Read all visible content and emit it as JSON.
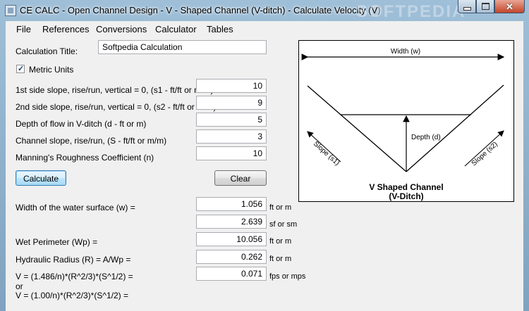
{
  "window": {
    "title": "CE CALC - Open Channel Design - V - Shaped Channel (V-ditch) - Calculate Velocity (V)",
    "watermark": "SOFTPEDIA",
    "close_glyph": "✕"
  },
  "menu": [
    "File",
    "References",
    "Conversions",
    "Calculator",
    "Tables"
  ],
  "form": {
    "calc_title_label": "Calculation Title:",
    "calc_title_value": "Softpedia Calculation",
    "metric_label": "Metric Units",
    "metric_checked": true,
    "check_glyph": "✓",
    "inputs": [
      {
        "label": "1st side slope, rise/run, vertical = 0, (s1 - ft/ft or m/m)",
        "value": "10"
      },
      {
        "label": "2nd side slope, rise/run, vertical = 0, (s2 - ft/ft or m/m)",
        "value": "9"
      },
      {
        "label": "Depth of flow in V-ditch (d - ft or m)",
        "value": "5"
      },
      {
        "label": "Channel slope, rise/run, (S - ft/ft or m/m)",
        "value": "3"
      },
      {
        "label": "Manning's Roughness Coefficient (n)",
        "value": "10"
      }
    ],
    "calculate_label": "Calculate",
    "clear_label": "Clear"
  },
  "results": [
    {
      "label": "Width of the water surface (w) =",
      "value": "1.056",
      "unit": "ft or m"
    },
    {
      "label": "",
      "value": "2.639",
      "unit": "sf or sm"
    },
    {
      "label": "Wet Perimeter (Wp) =",
      "value": "10.056",
      "unit": "ft or m"
    },
    {
      "label": "Hydraulic Radius (R) = A/Wp =",
      "value": "0.262",
      "unit": "ft or m"
    },
    {
      "label": "V   = (1.486/n)*(R^2/3)*(S^1/2) =",
      "value": "0.071",
      "unit": "fps or mps"
    }
  ],
  "formula_or": "or",
  "formula_alt": "V   = (1.00/n)*(R^2/3)*(S^1/2) =",
  "diagram": {
    "width_label": "Width (w)",
    "depth_label": "Depth (d)",
    "slope1_label": "Slope (s1)",
    "slope2_label": "Slope (s2)",
    "title_line1": "V  Shaped Channel",
    "title_line2": "(V-Ditch)"
  }
}
